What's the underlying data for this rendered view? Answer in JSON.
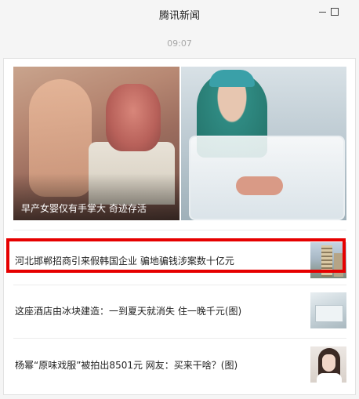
{
  "window": {
    "title": "腾讯新闻",
    "minimize_label": "最小化",
    "maximize_label": "最大化"
  },
  "feed": {
    "timestamp": "09:07",
    "hero": {
      "caption": "早产女婴仅有手掌大 奇迹存活"
    },
    "items": [
      {
        "headline": "河北邯郸招商引来假韩国企业 骗地骗钱涉案数十亿元",
        "thumb_icon": "building-thumbnail",
        "highlighted": true
      },
      {
        "headline": "这座酒店由冰块建造：一到夏天就消失 住一晚千元(图)",
        "thumb_icon": "ice-hotel-thumbnail",
        "highlighted": false
      },
      {
        "headline": "杨幂“原味戏服”被拍出8501元 网友：买来干啥？(图)",
        "thumb_icon": "actress-thumbnail",
        "highlighted": false
      }
    ]
  },
  "colors": {
    "highlight": "#e60000",
    "background": "#f5f5f5",
    "card": "#ffffff",
    "timestamp": "#a8a8a8"
  }
}
